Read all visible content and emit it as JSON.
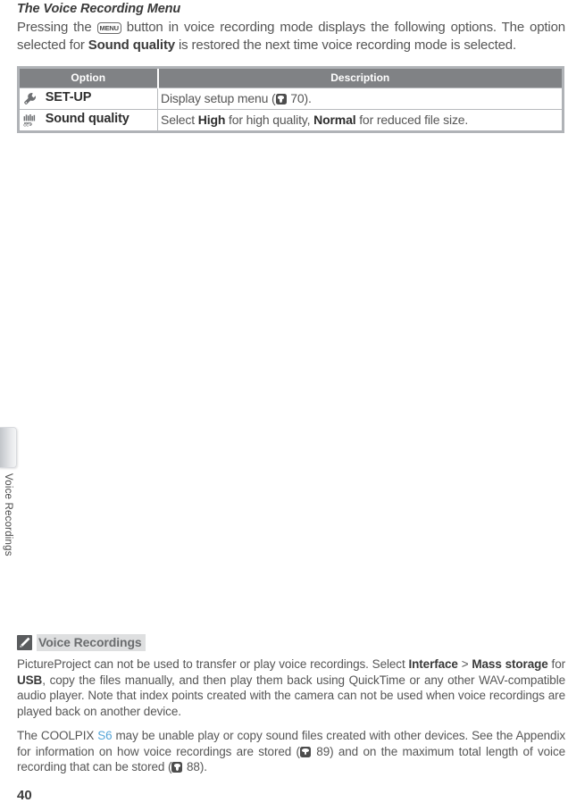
{
  "sidebar": {
    "tab_name": "chapter-tab",
    "vertical_label": "Voice Recordings"
  },
  "page": {
    "title": "The Voice Recording Menu",
    "number": "40"
  },
  "intro": {
    "part1": "Pressing the ",
    "menu_button_label": "MENU",
    "part2": " button in voice recording mode displays the following options. The option selected for ",
    "bold_term": "Sound quality",
    "part3": " is restored the next time voice recording mode is selected."
  },
  "table": {
    "headers": [
      "Option",
      "Description"
    ],
    "rows": [
      {
        "icon": "wrench-icon",
        "option": "SET-UP",
        "desc_prefix": "Display setup menu (",
        "ref_icon": "page-reference-icon",
        "ref_page": " 70).",
        "desc_suffix": ""
      },
      {
        "icon": "sound-wave-icon",
        "option": "Sound quality",
        "desc_prefix": "Select ",
        "bold1": "High",
        "desc_mid": " for high quality, ",
        "bold2": "Normal",
        "desc_suffix": " for reduced file size."
      }
    ]
  },
  "note": {
    "icon": "pencil-icon",
    "title": "Voice Recordings",
    "paragraph1": {
      "p1": "PictureProject can not be used to transfer or play voice recordings.  Select ",
      "b1": "Interface",
      "sep": " > ",
      "b2": "Mass storage",
      "p2": " for ",
      "b3": "USB",
      "p3": ", copy the files manually, and then play them back using QuickTime or any other WAV-compatible audio player.  Note that index points created with the camera can not be used when voice recordings are played back on another device."
    },
    "paragraph2": {
      "p1": "The COOLPIX ",
      "model": "S6",
      "p2": " may be unable play or copy sound files created with other devices.  See the Appendix for information on how voice recordings are stored (",
      "ref1_page": " 89) and on the maximum total length of voice recording that can be stored (",
      "ref2_page": " 88)."
    }
  },
  "colors": {
    "accent_blue": "#56a6d8",
    "table_header_gray": "#808285",
    "body_text": "#555555"
  }
}
